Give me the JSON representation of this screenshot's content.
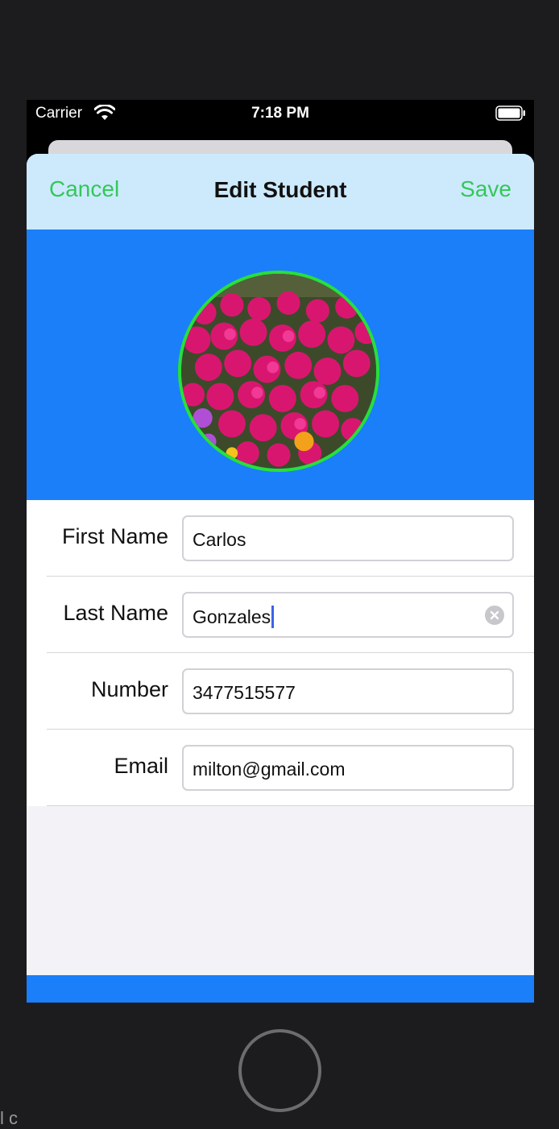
{
  "status_bar": {
    "carrier": "Carrier",
    "time": "7:18 PM",
    "wifi_icon": "wifi-icon",
    "battery_icon": "battery-icon"
  },
  "navbar": {
    "cancel_label": "Cancel",
    "title": "Edit Student",
    "save_label": "Save",
    "background": "#cdeafd",
    "accent": "#34c759"
  },
  "header": {
    "background": "#1a7ff9",
    "avatar_icon": "flower-photo",
    "avatar_border": "#28e03a"
  },
  "form": {
    "fields": [
      {
        "label": "First Name",
        "value": "Carlos"
      },
      {
        "label": "Last Name",
        "value": "Gonzales"
      },
      {
        "label": "Number",
        "value": "3477515577"
      },
      {
        "label": "Email",
        "value": "milton@gmail.com"
      }
    ],
    "clear_icon": "clear-circle-x-icon"
  },
  "edge_fragment": "l c"
}
